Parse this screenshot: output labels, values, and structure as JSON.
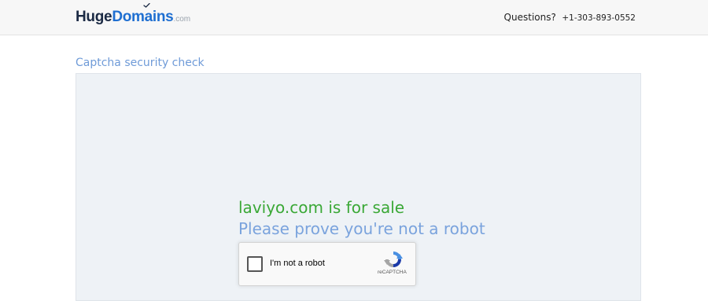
{
  "header": {
    "logo": {
      "part1": "Huge",
      "part2": "Domains",
      "suffix": ".com"
    },
    "questions_label": "Questions?",
    "phone": "+1-303-893-0552"
  },
  "main": {
    "section_title": "Captcha security check",
    "sale_text": "laviyo.com is for sale",
    "prove_text": "Please prove you're not a robot",
    "recaptcha": {
      "label": "I'm not a robot",
      "brand": "reCAPTCHA"
    }
  },
  "colors": {
    "header_bg": "#f7f7f7",
    "brand_navy": "#1b2a44",
    "brand_blue": "#1f6fd1",
    "title_blue": "#6f9bd8",
    "sale_green": "#3aa836",
    "prove_blue": "#7aa3dd",
    "panel_bg": "#eef2f6"
  },
  "icons": {
    "logo_accent": "checkmark-icon",
    "recaptcha_logo": "recaptcha-logo-icon"
  }
}
